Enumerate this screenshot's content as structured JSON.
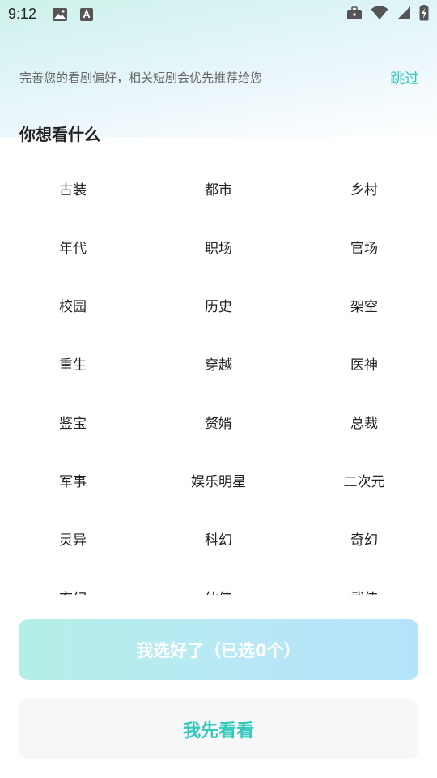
{
  "status_bar": {
    "time": "9:12",
    "left_icons": [
      "image-icon",
      "text-a-icon"
    ],
    "right_icons": [
      "briefcase-icon",
      "wifi-icon",
      "signal-icon",
      "battery-charging-icon"
    ]
  },
  "header": {
    "subtitle": "完善您的看剧偏好，相关短剧会优先推荐给您",
    "skip_label": "跳过"
  },
  "section_title": "你想看什么",
  "genres": [
    "古装",
    "都市",
    "乡村",
    "年代",
    "职场",
    "官场",
    "校园",
    "历史",
    "架空",
    "重生",
    "穿越",
    "医神",
    "鉴宝",
    "赘婿",
    "总裁",
    "军事",
    "娱乐明星",
    "二次元",
    "灵异",
    "科幻",
    "奇幻",
    "玄幻",
    "仙侠",
    "武侠"
  ],
  "buttons": {
    "confirm_label": "我选好了（已选0个）",
    "browse_label": "我先看看"
  },
  "colors": {
    "accent": "#35c9bc",
    "confirm_gradient_start": "#b4efe6",
    "confirm_gradient_end": "#b5e3fc",
    "browse_bg": "#f6f7f9"
  }
}
